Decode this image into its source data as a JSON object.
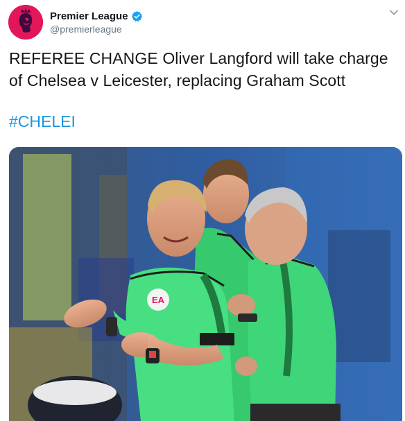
{
  "account": {
    "display_name": "Premier League",
    "handle": "@premierleague"
  },
  "tweet": {
    "text": "REFEREE CHANGE Oliver Langford will take charge of Chelsea v Leicester, replacing Graham Scott",
    "hashtag": "#CHELEI"
  },
  "media": {
    "badge_text": "EA"
  },
  "icons": {
    "avatar": "premier-league-lion-logo",
    "verified": "verified-badge-icon",
    "menu": "chevron-down-icon"
  },
  "colors": {
    "brand": "#e1175a",
    "link": "#1b95e0",
    "kit_green": "#3fd67a",
    "verified": "#1da1f2"
  }
}
